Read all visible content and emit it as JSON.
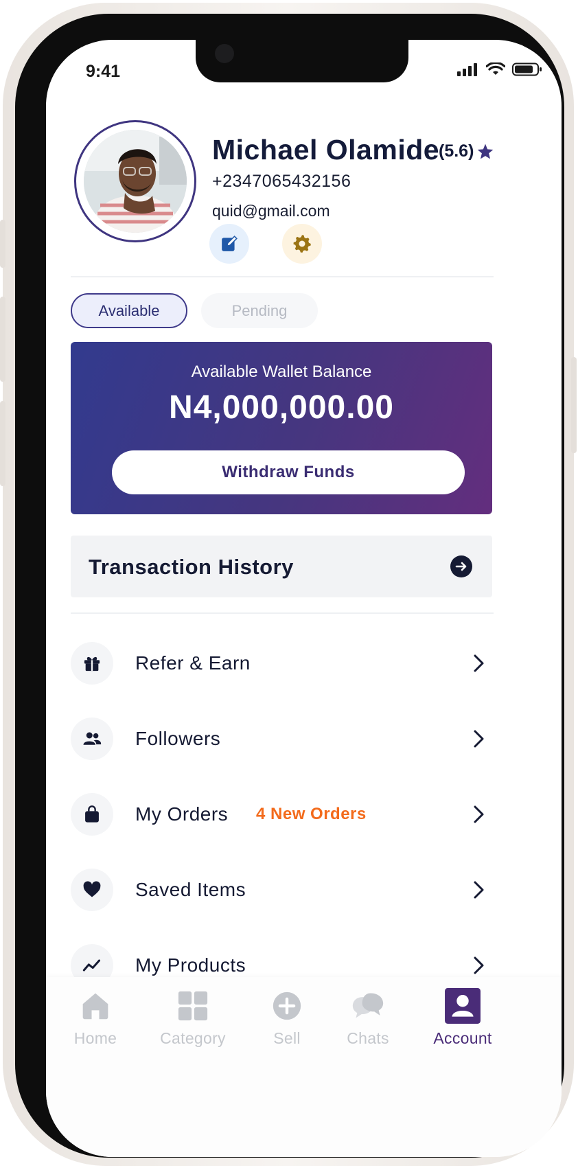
{
  "status_bar": {
    "time": "9:41"
  },
  "profile": {
    "name": "Michael Olamide",
    "rating": "(5.6)",
    "phone": "+2347065432156",
    "email": "quid@gmail.com"
  },
  "wallet": {
    "tabs": [
      {
        "label": "Available",
        "active": true
      },
      {
        "label": "Pending",
        "active": false
      }
    ],
    "balance_label": "Available Wallet Balance",
    "balance_amount": "N4,000,000.00",
    "withdraw_label": "Withdraw Funds"
  },
  "transaction_history": {
    "label": "Transaction History"
  },
  "menu": {
    "items": [
      {
        "label": "Refer & Earn",
        "icon": "gift-icon"
      },
      {
        "label": "Followers",
        "icon": "users-icon"
      },
      {
        "label": "My Orders",
        "icon": "shopping-bag-icon",
        "badge": "4 New Orders"
      },
      {
        "label": "Saved Items",
        "icon": "heart-icon"
      },
      {
        "label": "My Products",
        "icon": "trending-icon"
      }
    ]
  },
  "bottom_nav": {
    "items": [
      {
        "label": "Home",
        "icon": "home-icon",
        "active": false
      },
      {
        "label": "Category",
        "icon": "grid-icon",
        "active": false
      },
      {
        "label": "Sell",
        "icon": "plus-circle-icon",
        "active": false
      },
      {
        "label": "Chats",
        "icon": "chat-bubbles-icon",
        "active": false
      },
      {
        "label": "Account",
        "icon": "account-icon",
        "active": true
      }
    ]
  },
  "colors": {
    "primary": "#3f3580",
    "badge": "#f36b1c",
    "text_dark": "#151a33",
    "nav_inactive": "#c4c7cc",
    "nav_active": "#4a2c78"
  }
}
